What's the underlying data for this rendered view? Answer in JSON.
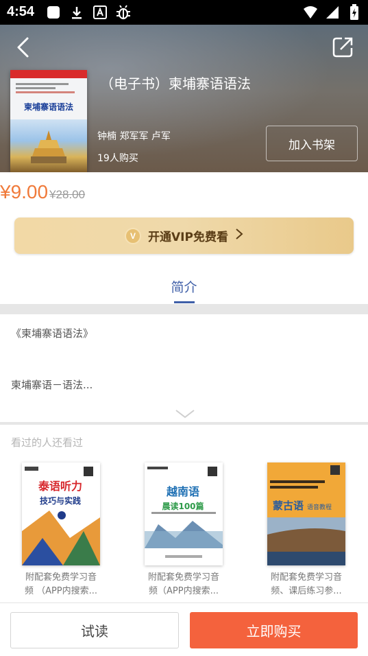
{
  "status_bar": {
    "time": "4:54",
    "icons": [
      "app-square-icon",
      "download-icon",
      "font-a-icon",
      "bug-icon"
    ],
    "right_icons": [
      "wifi-icon",
      "signal-icon",
      "battery-charging-icon"
    ]
  },
  "header": {
    "back_icon": "chevron-left-icon",
    "share_icon": "share-external-icon",
    "book_title": "（电子书）柬埔寨语语法",
    "authors": "钟楠 郑军军 卢军",
    "buyers": "19人购买",
    "add_shelf_label": "加入书架",
    "cover_title": "柬埔寨语语法"
  },
  "price": {
    "current": "¥9.00",
    "original": "¥28.00",
    "color": "#f07a3a"
  },
  "vip": {
    "badge": "V",
    "label": "开通VIP免费看",
    "arrow": "›"
  },
  "tabs": {
    "intro_label": "简介",
    "accent": "#3f5fa8"
  },
  "intro": {
    "title": "《柬埔寨语语法》",
    "body": "柬埔寨语－语法..."
  },
  "related": {
    "heading": "看过的人还看过",
    "books": [
      {
        "cover_title": "泰语听力",
        "cover_sub": "技巧与实践",
        "desc_line1": "附配套免费学习音",
        "desc_line2": "频 （APP内搜索..."
      },
      {
        "cover_title": "越南语",
        "cover_sub": "晨读100篇",
        "desc_line1": "附配套免费学习音",
        "desc_line2": "频（APP内搜索..."
      },
      {
        "cover_title": "蒙古语",
        "cover_sub": "语音教程",
        "desc_line1": "附配套免费学习音",
        "desc_line2": "频、课后练习参..."
      }
    ]
  },
  "bottom_bar": {
    "trial_label": "试读",
    "buy_label": "立即购买",
    "buy_color": "#f4623d"
  }
}
